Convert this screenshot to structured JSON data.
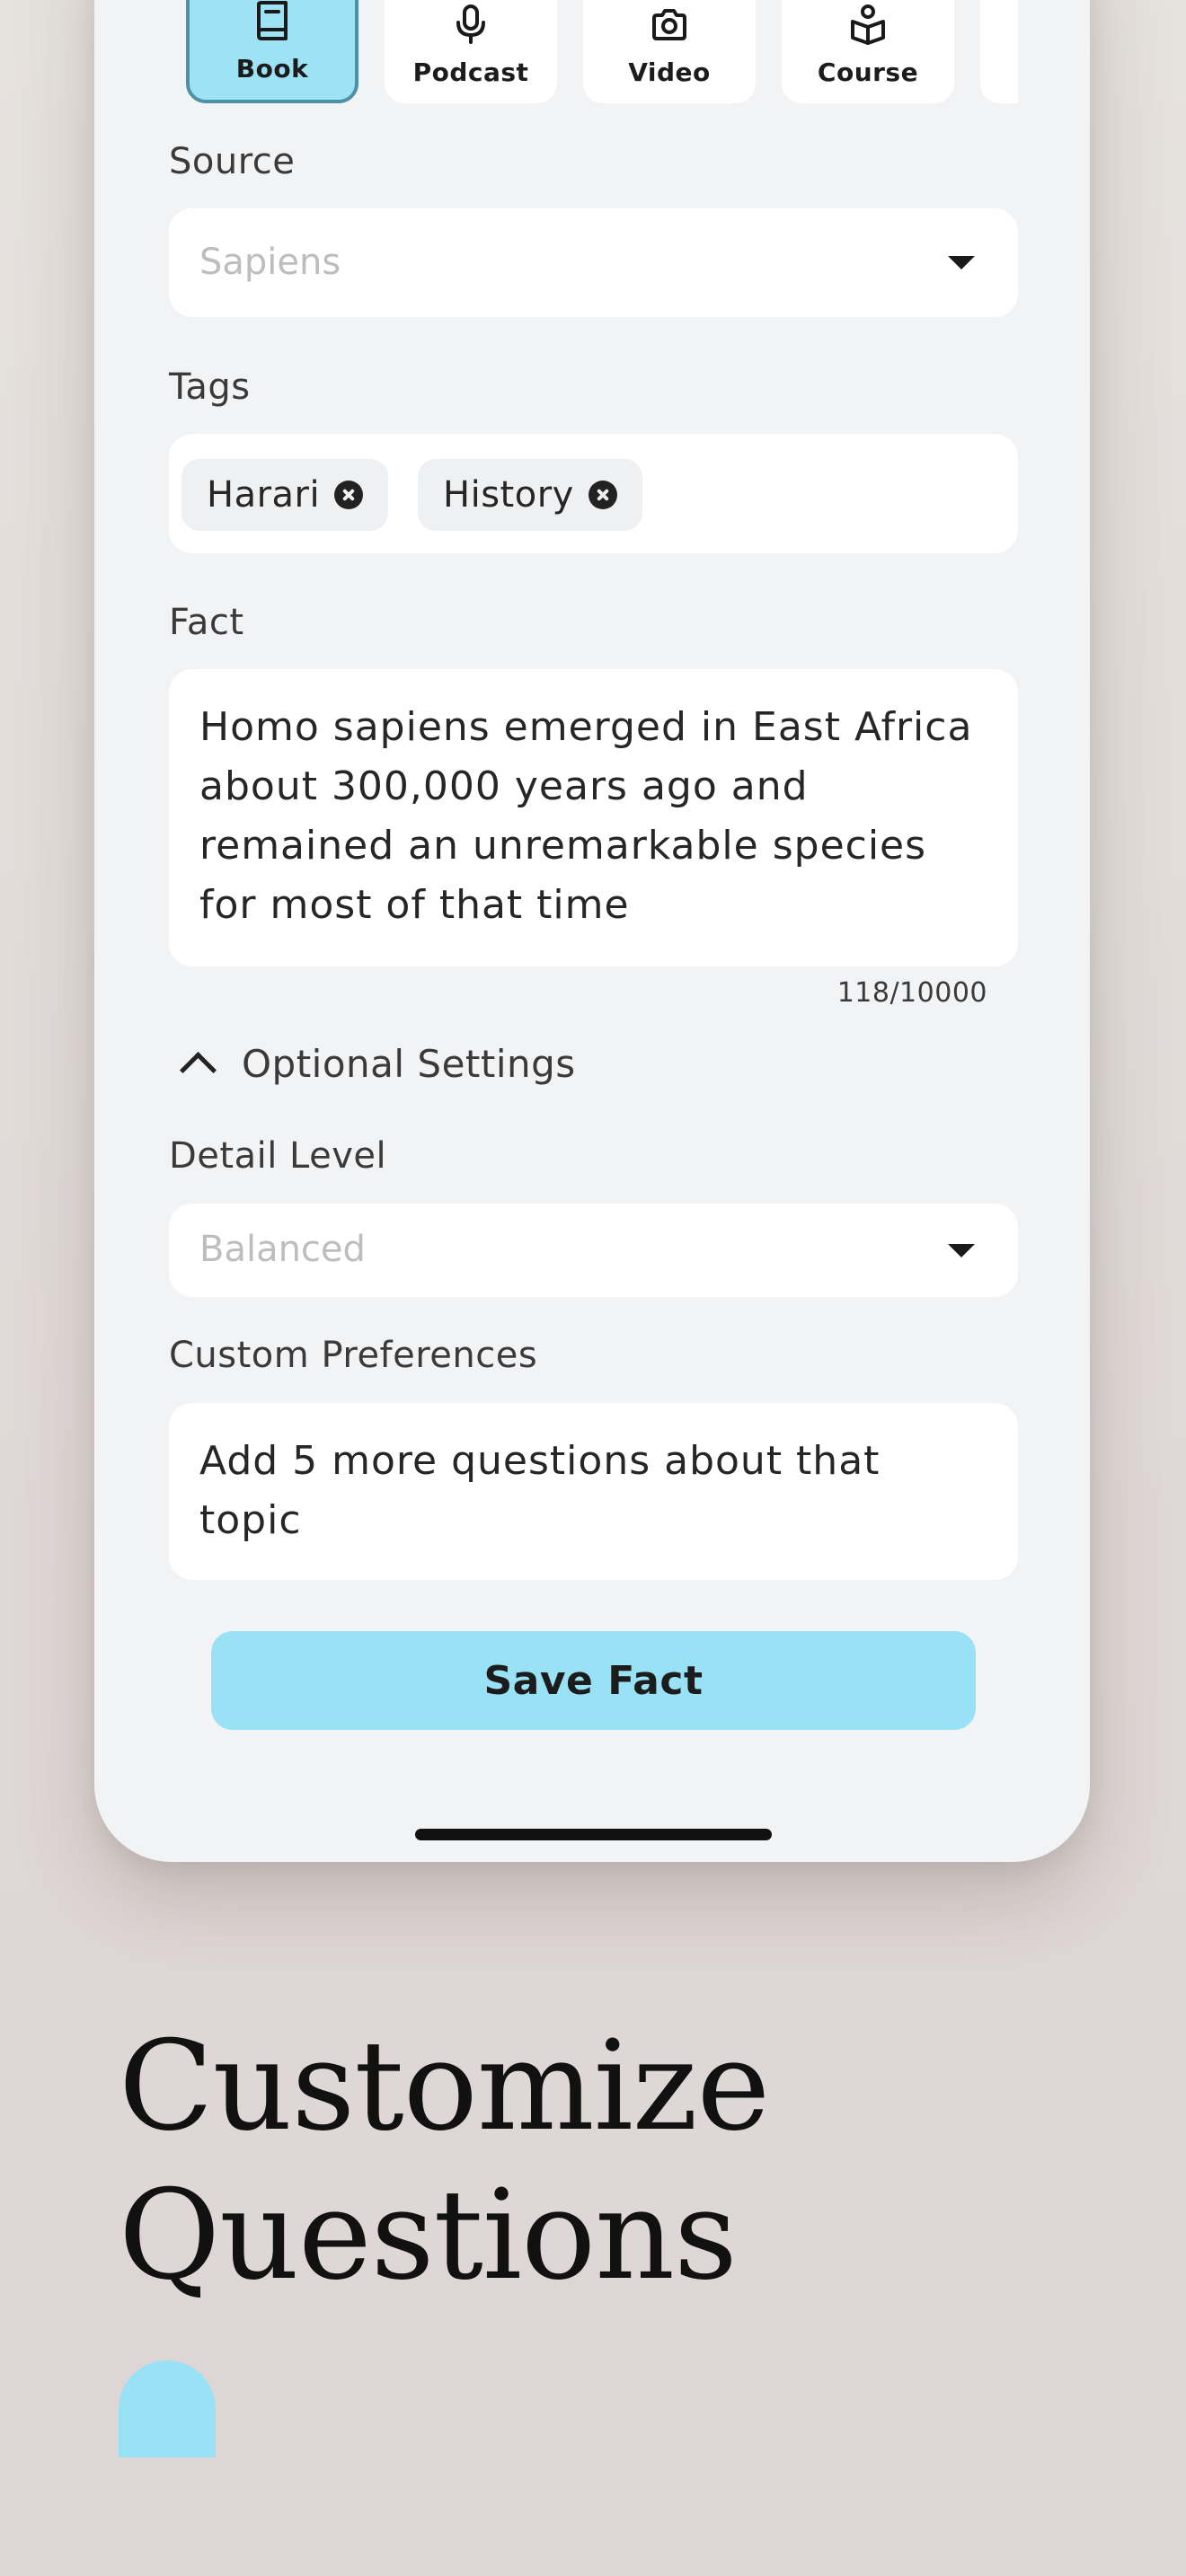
{
  "content_types": [
    {
      "label": "Book",
      "icon": "book-icon",
      "active": true
    },
    {
      "label": "Podcast",
      "icon": "microphone-icon",
      "active": false
    },
    {
      "label": "Video",
      "icon": "camera-icon",
      "active": false
    },
    {
      "label": "Course",
      "icon": "course-icon",
      "active": false
    }
  ],
  "source": {
    "label": "Source",
    "placeholder": "Sapiens"
  },
  "tags": {
    "label": "Tags",
    "items": [
      "Harari",
      "History"
    ]
  },
  "fact": {
    "label": "Fact",
    "value": "Homo sapiens emerged in East Africa about 300,000 years ago and remained an unremarkable species for most of that time",
    "counter": "118/10000"
  },
  "optional": {
    "label": "Optional Settings"
  },
  "detail_level": {
    "label": "Detail Level",
    "placeholder": "Balanced"
  },
  "custom_preferences": {
    "label": "Custom Preferences",
    "value": "Add 5 more questions about that topic"
  },
  "save_button": {
    "label": "Save Fact"
  },
  "headline": {
    "line1": "Customize",
    "line2": "Questions"
  },
  "colors": {
    "accent": "#99e1f5",
    "accent_border": "#4a92a4",
    "background": "#f2f3f5"
  }
}
